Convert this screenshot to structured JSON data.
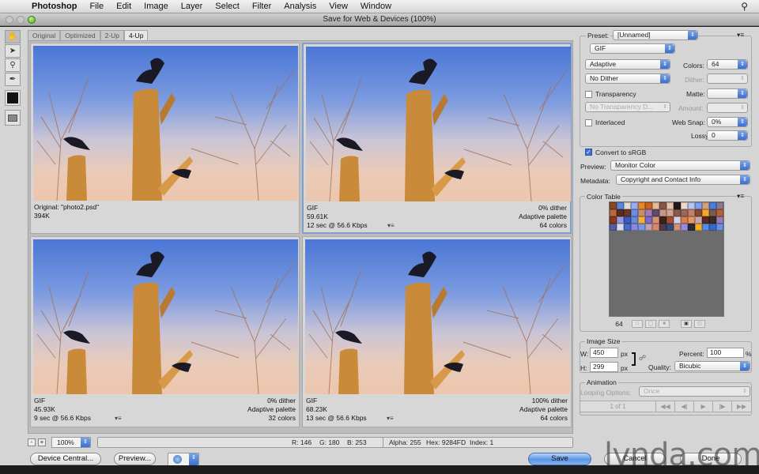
{
  "menubar": {
    "app": "Photoshop",
    "items": [
      "File",
      "Edit",
      "Image",
      "Layer",
      "Select",
      "Filter",
      "Analysis",
      "View",
      "Window"
    ]
  },
  "window": {
    "title": "Save for Web & Devices (100%)"
  },
  "tools": [
    "hand-tool",
    "slice-select-tool",
    "zoom-tool",
    "eyedropper-tool"
  ],
  "tabs": [
    {
      "label": "Original",
      "active": false
    },
    {
      "label": "Optimized",
      "active": false
    },
    {
      "label": "2-Up",
      "active": false
    },
    {
      "label": "4-Up",
      "active": true
    }
  ],
  "panes": [
    {
      "left": [
        "Original: \"photo2.psd\"",
        "394K",
        ""
      ],
      "right": [
        "",
        "",
        ""
      ],
      "selected": false
    },
    {
      "left": [
        "GIF",
        "59.61K",
        "12 sec @ 56.6 Kbps"
      ],
      "right": [
        "0% dither",
        "Adaptive palette",
        "64 colors"
      ],
      "selected": true
    },
    {
      "left": [
        "GIF",
        "45.93K",
        "9 sec @ 56.6 Kbps"
      ],
      "right": [
        "0% dither",
        "Adaptive palette",
        "32 colors"
      ],
      "selected": false
    },
    {
      "left": [
        "GIF",
        "68.23K",
        "13 sec @ 56.6 Kbps"
      ],
      "right": [
        "100% dither",
        "Adaptive palette",
        "64 colors"
      ],
      "selected": false
    }
  ],
  "status": {
    "zoom": "100%",
    "r": "R: 146",
    "g": "G: 180",
    "b": "B: 253",
    "alpha": "Alpha: 255",
    "hex": "Hex: 9284FD",
    "index": "Index: 1"
  },
  "buttons": {
    "device_central": "Device Central...",
    "preview": "Preview...",
    "save": "Save",
    "cancel": "Cancel",
    "done": "Done"
  },
  "settings": {
    "preset_label": "Preset:",
    "preset": "[Unnamed]",
    "format": "GIF",
    "reduction": "Adaptive",
    "dither_algo": "No Dither",
    "colors_label": "Colors:",
    "colors": "64",
    "dither_label": "Dither:",
    "dither": "",
    "transparency_label": "Transparency",
    "transparency": false,
    "matte_label": "Matte:",
    "matte": "",
    "transparency_dither": "No Transparency D...",
    "amount_label": "Amount:",
    "amount": "",
    "interlaced_label": "Interlaced",
    "interlaced": false,
    "websnap_label": "Web Snap:",
    "websnap": "0%",
    "lossy_label": "Lossy:",
    "lossy": "0",
    "srgb_label": "Convert to sRGB",
    "srgb": true,
    "preview_label": "Preview:",
    "preview": "Monitor Color",
    "metadata_label": "Metadata:",
    "metadata": "Copyright and Contact Info"
  },
  "color_table": {
    "title": "Color Table",
    "count": "64",
    "colors": [
      "#8a4a24",
      "#5b86e0",
      "#e6d8d2",
      "#98aef0",
      "#e7862a",
      "#c9621e",
      "#e6b898",
      "#8c5446",
      "#e2c2b0",
      "#231818",
      "#ecd8cc",
      "#b8c4ec",
      "#7f9ef0",
      "#d89f7e",
      "#4a7de0",
      "#8a7a8c",
      "#b46a3e",
      "#5a2a1c",
      "#6a3626",
      "#6a8ee4",
      "#c68e6e",
      "#a47ab8",
      "#5e4a6a",
      "#c69888",
      "#d0a490",
      "#8a5a4a",
      "#9a6a58",
      "#c2826c",
      "#8a4a2a",
      "#f0a830",
      "#7a5a52",
      "#b86232",
      "#8a3a18",
      "#9a96d8",
      "#3a5ac0",
      "#6a8ad8",
      "#f0b040",
      "#7a6ac8",
      "#d89070",
      "#3a2418",
      "#a05030",
      "#d8d0e8",
      "#d88048",
      "#e49860",
      "#c8a8b8",
      "#5a2a1a",
      "#3a2a28",
      "#9a7ab8",
      "#5a5aa0",
      "#d8dcf0",
      "#4a6ac8",
      "#8a8ae0",
      "#7a9ae0",
      "#c0a0b0",
      "#d88a68",
      "#4a3a50",
      "#3a4a78",
      "#d0907a",
      "#9a8ae0",
      "#2a2a3a",
      "#f0b020",
      "#5a8ae8",
      "#3a68c8",
      "#6a90e0"
    ]
  },
  "image_size": {
    "title": "Image Size",
    "w_label": "W:",
    "w": "450",
    "h_label": "H:",
    "h": "299",
    "unit": "px",
    "percent_label": "Percent:",
    "percent": "100",
    "percent_unit": "%",
    "quality_label": "Quality:",
    "quality": "Bicubic"
  },
  "animation": {
    "title": "Animation",
    "looping_label": "Looping Options:",
    "looping": "Once",
    "frame": "1 of 1"
  },
  "watermark": "lynda.com"
}
